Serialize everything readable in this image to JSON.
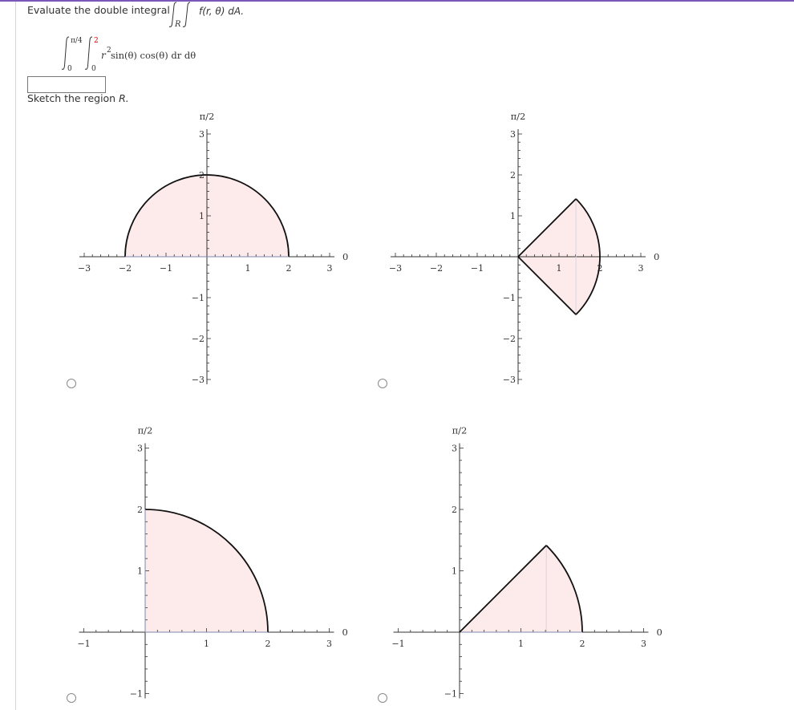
{
  "question": {
    "prompt": "Evaluate the double integral",
    "integral_region": "R",
    "integrand_text": "f(r, θ) dA.",
    "iterated_integral": {
      "outer_lower": "0",
      "outer_upper": "π/4",
      "inner_lower": "0",
      "inner_upper": "2",
      "inner_upper_color": "#cc0000",
      "integrand": "r",
      "integrand_exp": "2",
      "integrand_rest": " sin(θ) cos(θ) dr dθ"
    },
    "answer_value": "",
    "sketch_prompt": "Sketch the region",
    "sketch_var": "R."
  },
  "colors": {
    "accent_top_bar": "#7b57b8",
    "region_fill": "#fdeaea",
    "region_stroke": "#111111",
    "axis": "#333333"
  },
  "options": [
    {
      "id": "option-1",
      "selected": false,
      "chart_data": {
        "type": "polar-region",
        "region": {
          "r_min": 0,
          "r_max": 2,
          "theta_min_deg": 0,
          "theta_max_deg": 180
        },
        "x_ticks": [
          "-3",
          "-2",
          "-1",
          "1",
          "2",
          "3"
        ],
        "x_tick_values": [
          -3,
          -2,
          -1,
          1,
          2,
          3
        ],
        "y_ticks": [
          "3",
          "2",
          "1",
          "-1",
          "-2",
          "-3"
        ],
        "y_tick_values": [
          3,
          2,
          1,
          -1,
          -2,
          -3
        ],
        "xlim": [
          -3,
          3
        ],
        "ylim": [
          -3,
          3
        ],
        "angle_label_top": "π/2",
        "angle_label_right": "0"
      }
    },
    {
      "id": "option-2",
      "selected": false,
      "chart_data": {
        "type": "polar-region",
        "region": {
          "r_min": 0,
          "r_max": 2,
          "theta_min_deg": -45,
          "theta_max_deg": 45
        },
        "x_ticks": [
          "-3",
          "-2",
          "-1",
          "1",
          "2",
          "3"
        ],
        "x_tick_values": [
          -3,
          -2,
          -1,
          1,
          2,
          3
        ],
        "y_ticks": [
          "3",
          "2",
          "1",
          "-1",
          "-2",
          "-3"
        ],
        "y_tick_values": [
          3,
          2,
          1,
          -1,
          -2,
          -3
        ],
        "xlim": [
          -3,
          3
        ],
        "ylim": [
          -3,
          3
        ],
        "angle_label_top": "π/2",
        "angle_label_right": "0"
      }
    },
    {
      "id": "option-3",
      "selected": false,
      "chart_data": {
        "type": "polar-region",
        "region": {
          "r_min": 0,
          "r_max": 2,
          "theta_min_deg": 0,
          "theta_max_deg": 90
        },
        "x_ticks": [
          "-1",
          "1",
          "2",
          "3"
        ],
        "x_tick_values": [
          -1,
          1,
          2,
          3
        ],
        "y_ticks": [
          "3",
          "2",
          "1",
          "-1"
        ],
        "y_tick_values": [
          3,
          2,
          1,
          -1
        ],
        "xlim": [
          -1,
          3
        ],
        "ylim": [
          -1,
          3
        ],
        "angle_label_top": "π/2",
        "angle_label_right": "0"
      }
    },
    {
      "id": "option-4",
      "selected": false,
      "chart_data": {
        "type": "polar-region",
        "region": {
          "r_min": 0,
          "r_max": 2,
          "theta_min_deg": 0,
          "theta_max_deg": 45
        },
        "x_ticks": [
          "-1",
          "1",
          "2",
          "3"
        ],
        "x_tick_values": [
          -1,
          1,
          2,
          3
        ],
        "y_ticks": [
          "3",
          "2",
          "1",
          "-1"
        ],
        "y_tick_values": [
          3,
          2,
          1,
          -1
        ],
        "xlim": [
          -1,
          3
        ],
        "ylim": [
          -1,
          3
        ],
        "angle_label_top": "π/2",
        "angle_label_right": "0"
      }
    }
  ]
}
